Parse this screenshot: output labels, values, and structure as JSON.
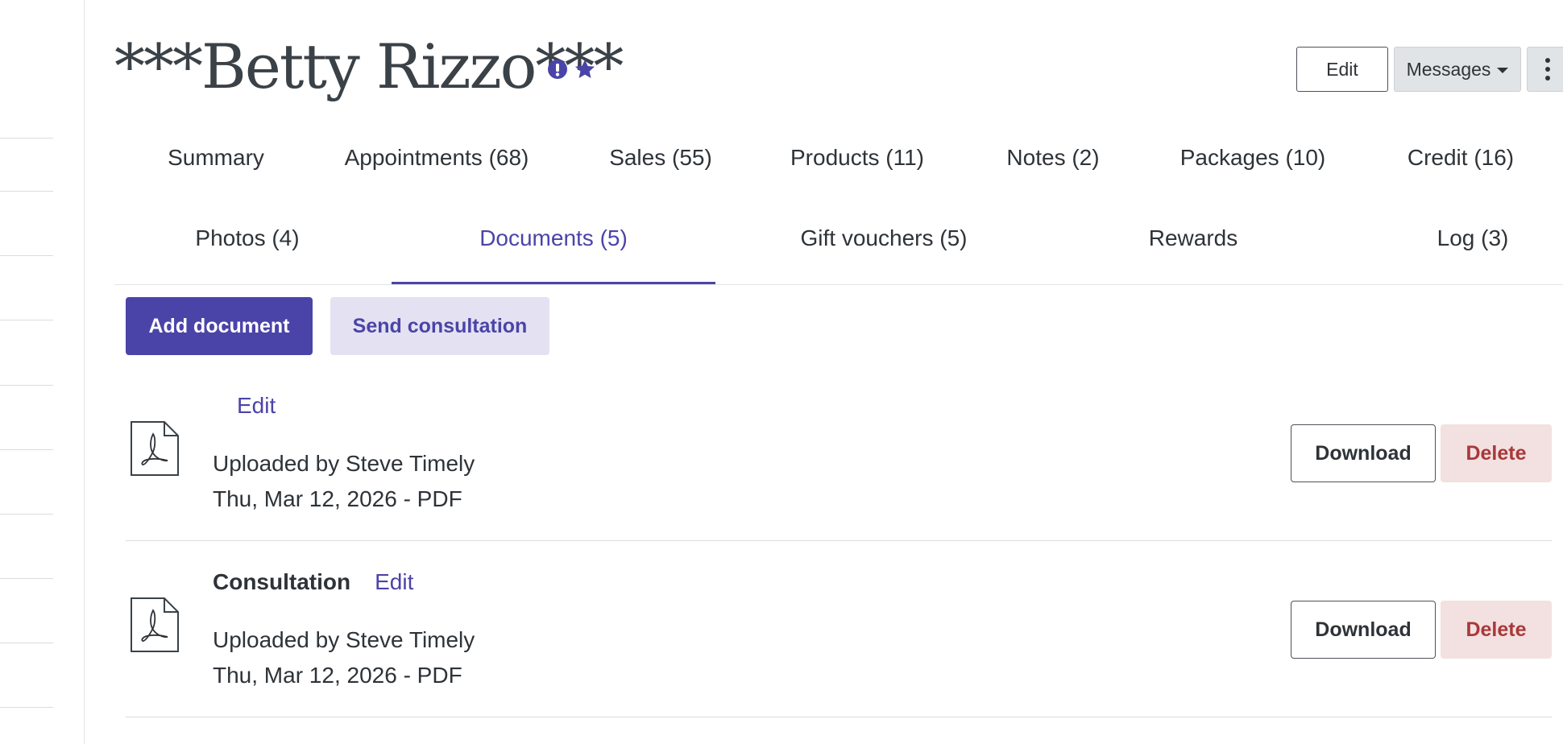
{
  "client": {
    "name": "***Betty Rizzo***",
    "icons": [
      "alert-icon",
      "star-icon"
    ]
  },
  "header": {
    "edit_label": "Edit",
    "messages_label": "Messages"
  },
  "tabs": {
    "row1": [
      "Summary",
      "Appointments (68)",
      "Sales (55)",
      "Products (11)",
      "Notes (2)",
      "Packages (10)",
      "Credit (16)"
    ],
    "row2": [
      "Photos (4)",
      "Documents (5)",
      "Gift vouchers (5)",
      "Rewards",
      "Log (3)"
    ],
    "active": "Documents (5)"
  },
  "actions": {
    "add_document": "Add document",
    "send_consultation": "Send consultation"
  },
  "documents": [
    {
      "name": "",
      "edit_label": "Edit",
      "uploaded_by": "Uploaded by Steve Timely",
      "date_type": "Thu, Mar 12, 2026 - PDF",
      "download_label": "Download",
      "delete_label": "Delete"
    },
    {
      "name": "Consultation",
      "edit_label": "Edit",
      "uploaded_by": "Uploaded by Steve Timely",
      "date_type": "Thu, Mar 12, 2026 - PDF",
      "download_label": "Download",
      "delete_label": "Delete"
    }
  ],
  "colors": {
    "accent": "#4b44a8",
    "danger_text": "#a8383a",
    "danger_bg": "#f3e0e0",
    "secondary_bg": "#e4e2f2"
  }
}
